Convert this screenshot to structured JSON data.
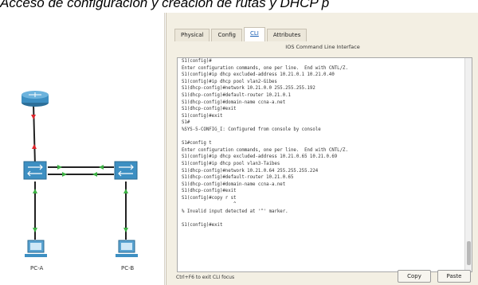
{
  "caption": "Acceso de configuración y creación de rutas y DHCP p",
  "topology": {
    "devices": {
      "router": {
        "label": ""
      },
      "switch_left": {
        "label": ""
      },
      "switch_right": {
        "label": ""
      },
      "pc_a": {
        "label": "PC-A"
      },
      "pc_b": {
        "label": "PC-B"
      }
    },
    "colors": {
      "link_up": "#3cb043",
      "link_down": "#e0242a",
      "device_blue": "#3d8fc2"
    }
  },
  "window": {
    "tabs": [
      {
        "label": "Physical",
        "active": false
      },
      {
        "label": "Config",
        "active": false
      },
      {
        "label": "CLI",
        "active": true
      },
      {
        "label": "Attributes",
        "active": false
      }
    ],
    "panel_title": "IOS Command Line Interface",
    "terminal_lines": [
      "S1(config)#",
      "Enter configuration commands, one per line.  End with CNTL/Z.",
      "S1(config)#ip dhcp excluded-address 10.21.0.1 10.21.0.40",
      "S1(config)#ip dhcp pool vlan2-Gibes",
      "S1(dhcp-config)#network 10.21.0.0 255.255.255.192",
      "S1(dhcp-config)#default-router 10.21.0.1",
      "S1(dhcp-config)#domain-name ccna-a.net",
      "S1(dhcp-config)#exit",
      "S1(config)#exit",
      "S1#",
      "%SYS-5-CONFIG_I: Configured from console by console",
      "",
      "S1#config t",
      "Enter configuration commands, one per line.  End with CNTL/Z.",
      "S1(config)#ip dhcp excluded-address 10.21.0.65 10.21.0.69",
      "S1(config)#ip dhcp pool vlan3-Taibes",
      "S1(dhcp-config)#network 10.21.0.64 255.255.255.224",
      "S1(dhcp-config)#default-router 10.21.0.65",
      "S1(dhcp-config)#domain-name ccna-a.net",
      "S1(dhcp-config)#exit",
      "S1(config)#copy r st",
      "                   ^",
      "% Invalid input detected at '^' marker.",
      "",
      "S1(config)#exit"
    ],
    "status_text": "Ctrl+F6 to exit CLI focus",
    "buttons": {
      "copy": "Copy",
      "paste": "Paste"
    }
  }
}
